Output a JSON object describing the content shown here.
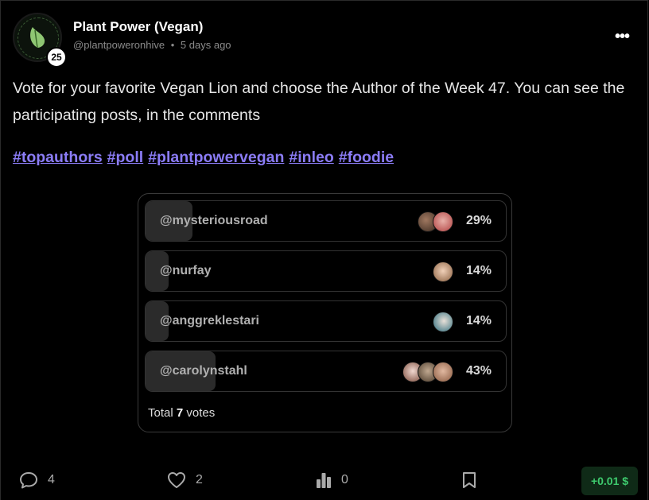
{
  "post": {
    "author_name": "Plant Power (Vegan)",
    "handle": "@plantpoweronhive",
    "separator": "•",
    "time_ago": "5 days ago",
    "reputation": "25",
    "more_label": "•••",
    "body": "Vote for your favorite Vegan Lion and choose the Author of the Week 47. You can see the participating posts, in the comments",
    "tags": [
      "#topauthors",
      "#poll",
      "#plantpowervegan",
      "#inleo",
      "#foodie"
    ]
  },
  "poll": {
    "options": [
      {
        "label": "@mysteriousroad",
        "percent_text": "29%",
        "percent": 29
      },
      {
        "label": "@nurfay",
        "percent_text": "14%",
        "percent": 14
      },
      {
        "label": "@anggreklestari",
        "percent_text": "14%",
        "percent": 14
      },
      {
        "label": "@carolynstahl",
        "percent_text": "43%",
        "percent": 43
      }
    ],
    "total_prefix": "Total",
    "total_votes": "7",
    "total_suffix": "votes"
  },
  "actions": {
    "comments": "4",
    "likes": "2",
    "views": "0",
    "payout": "+0.01 $"
  },
  "colors": {
    "accent_link": "#8b7cf6",
    "payout_green": "#3ecb6e"
  }
}
